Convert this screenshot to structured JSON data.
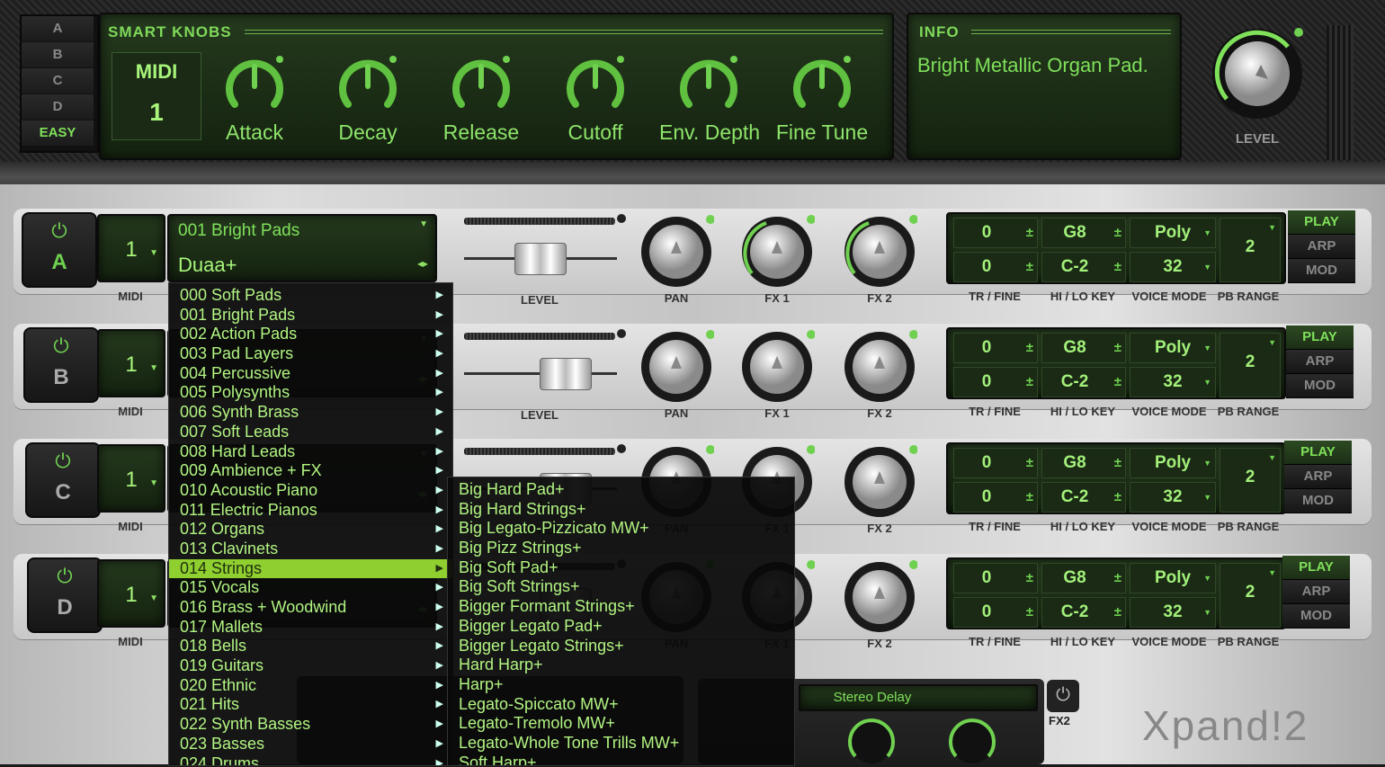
{
  "bank_tabs": [
    "A",
    "B",
    "C",
    "D",
    "EASY"
  ],
  "smart_knobs": {
    "title": "SMART KNOBS",
    "midi_label": "MIDI",
    "midi_value": "1",
    "knobs": [
      "Attack",
      "Decay",
      "Release",
      "Cutoff",
      "Env. Depth",
      "Fine Tune"
    ]
  },
  "info": {
    "title": "INFO",
    "text": "Bright Metallic Organ Pad."
  },
  "level_label": "LEVEL",
  "parts": [
    {
      "letter": "A",
      "midi": "1",
      "category": "001 Bright Pads",
      "preset": "Duaa+",
      "tr": "0",
      "fine": "0",
      "hikey": "G8",
      "lokey": "C-2",
      "voice_mode": "Poly",
      "voices": "32",
      "pb_range": "2"
    },
    {
      "letter": "B",
      "midi": "1",
      "category": "",
      "preset": "",
      "tr": "0",
      "fine": "0",
      "hikey": "G8",
      "lokey": "C-2",
      "voice_mode": "Poly",
      "voices": "32",
      "pb_range": "2"
    },
    {
      "letter": "C",
      "midi": "1",
      "category": "",
      "preset": "",
      "tr": "0",
      "fine": "0",
      "hikey": "G8",
      "lokey": "C-2",
      "voice_mode": "Poly",
      "voices": "32",
      "pb_range": "2"
    },
    {
      "letter": "D",
      "midi": "1",
      "category": "",
      "preset": "",
      "tr": "0",
      "fine": "0",
      "hikey": "G8",
      "lokey": "C-2",
      "voice_mode": "Poly",
      "voices": "32",
      "pb_range": "2"
    }
  ],
  "part_labels": {
    "midi": "MIDI",
    "level": "LEVEL",
    "pan": "PAN",
    "fx1": "FX 1",
    "fx2": "FX 2",
    "tr_fine": "TR / FINE",
    "hilo_key": "HI / LO KEY",
    "voice_mode": "VOICE MODE",
    "pb_range": "PB RANGE"
  },
  "pam_buttons": [
    "PLAY",
    "ARP",
    "MOD"
  ],
  "category_menu": [
    "000 Soft Pads",
    "001 Bright Pads",
    "002 Action Pads",
    "003 Pad Layers",
    "004 Percussive",
    "005 Polysynths",
    "006 Synth Brass",
    "007 Soft Leads",
    "008 Hard Leads",
    "009 Ambience + FX",
    "010 Acoustic Piano",
    "011 Electric Pianos",
    "012 Organs",
    "013 Clavinets",
    "014 Strings",
    "015 Vocals",
    "016 Brass + Woodwind",
    "017 Mallets",
    "018 Bells",
    "019 Guitars",
    "020 Ethnic",
    "021 Hits",
    "022 Synth Basses",
    "023 Basses",
    "024 Drums"
  ],
  "category_selected_index": 14,
  "preset_menu": [
    "Big Hard Pad+",
    "Big Hard Strings+",
    "Big Legato-Pizzicato MW+",
    "Big Pizz Strings+",
    "Big Soft Pad+",
    "Big Soft Strings+",
    "Bigger Formant Strings+",
    "Bigger Legato Pad+",
    "Bigger Legato Strings+",
    "Hard Harp+",
    "Harp+",
    "Legato-Spiccato MW+",
    "Legato-Tremolo MW+",
    "Legato-Whole Tone Trills MW+",
    "Soft Harp+"
  ],
  "fx": {
    "stereo_delay": "Stereo Delay",
    "fx2_label": "FX2",
    "logo": "Xpand!2"
  },
  "colors": {
    "lcd_green": "#7fe05a",
    "selected_item": "#8fcf2f",
    "lcd_bg": "#1b2c16"
  }
}
